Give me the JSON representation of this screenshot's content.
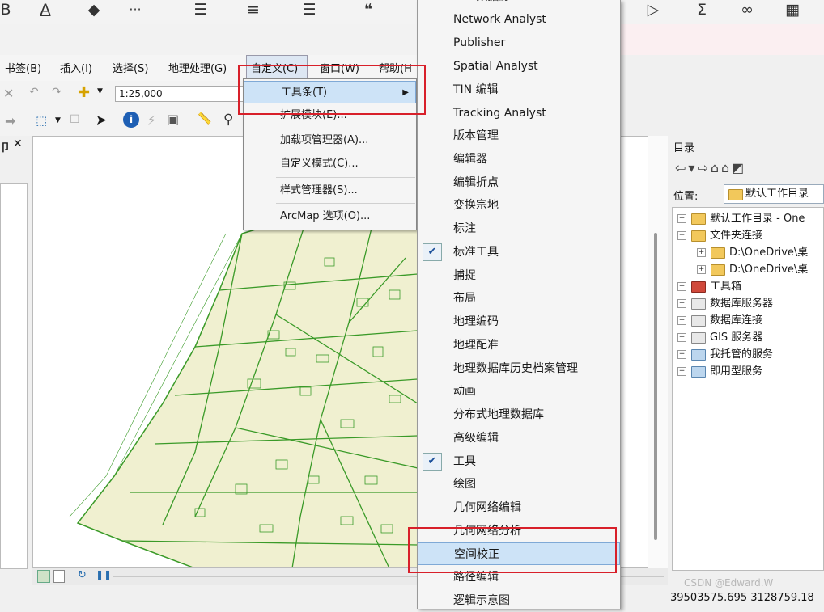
{
  "top_toolbar": {
    "icons": [
      {
        "name": "bold-icon",
        "glyph": "B"
      },
      {
        "name": "font-color-icon",
        "glyph": "A"
      },
      {
        "name": "fill-color-icon",
        "glyph": "◆"
      },
      {
        "name": "more-icon",
        "glyph": "···"
      },
      {
        "name": "bullet-list-icon",
        "glyph": "☰"
      },
      {
        "name": "align-icon",
        "glyph": "≡"
      },
      {
        "name": "indent-icon",
        "glyph": "☰"
      },
      {
        "name": "quote-icon",
        "glyph": "❝"
      },
      {
        "name": "play-icon",
        "glyph": "▷"
      },
      {
        "name": "sum-icon",
        "glyph": "Σ"
      },
      {
        "name": "link-icon",
        "glyph": "∞"
      },
      {
        "name": "grid-icon",
        "glyph": "▦"
      }
    ]
  },
  "menu_bar": {
    "bookmarks": "书签(B)",
    "insert": "插入(I)",
    "selection": "选择(S)",
    "geoprocessing": "地理处理(G)",
    "customize": "自定义(C)",
    "window": "窗口(W)",
    "help": "帮助(H"
  },
  "toolbar": {
    "scale": "1:25,000"
  },
  "toc": {
    "close_glyph": "✕",
    "partial_title": "卩"
  },
  "customize_menu": {
    "items": [
      "工具条(T)",
      "扩展模块(E)...",
      "加载项管理器(A)...",
      "自定义模式(C)...",
      "样式管理器(S)...",
      "ArcMap 选项(O)..."
    ]
  },
  "toolbars_menu": {
    "partial_top": "GIS 数据源",
    "items": [
      "Network Analyst",
      "Publisher",
      "Spatial Analyst",
      "TIN 编辑",
      "Tracking Analyst",
      "版本管理",
      "编辑器",
      "编辑折点",
      "变换宗地",
      "标注",
      "标准工具",
      "捕捉",
      "布局",
      "地理编码",
      "地理配准",
      "地理数据库历史档案管理",
      "动画",
      "分布式地理数据库",
      "高级编辑",
      "工具",
      "绘图",
      "几何网络编辑",
      "几何网络分析",
      "空间校正",
      "路径编辑",
      "逻辑示意图"
    ],
    "checked": [
      "标准工具",
      "工具"
    ],
    "highlighted": "空间校正"
  },
  "catalog": {
    "title": "目录",
    "location_label": "位置:",
    "location_value": "默认工作目录",
    "tree": [
      {
        "label": "默认工作目录 - One",
        "level": 0,
        "expander": "+"
      },
      {
        "label": "文件夹连接",
        "level": 0,
        "expander": "−"
      },
      {
        "label": "D:\\OneDrive\\桌",
        "level": 1,
        "expander": "+"
      },
      {
        "label": "D:\\OneDrive\\桌",
        "level": 1,
        "expander": "+"
      },
      {
        "label": "工具箱",
        "level": 0,
        "expander": "+"
      },
      {
        "label": "数据库服务器",
        "level": 0,
        "expander": "+"
      },
      {
        "label": "数据库连接",
        "level": 0,
        "expander": "+"
      },
      {
        "label": "GIS 服务器",
        "level": 0,
        "expander": "+"
      },
      {
        "label": "我托管的服务",
        "level": 0,
        "expander": "+"
      },
      {
        "label": "即用型服务",
        "level": 0,
        "expander": "+"
      }
    ]
  },
  "status": {
    "coordinates": "39503575.695  3128759.18",
    "watermark": "CSDN @Edward.W"
  },
  "colors": {
    "map_fill": "#f0f0d0",
    "map_lines": "#3a9a28",
    "highlight": "#cde3f7",
    "annotation_red": "#d8202a"
  }
}
